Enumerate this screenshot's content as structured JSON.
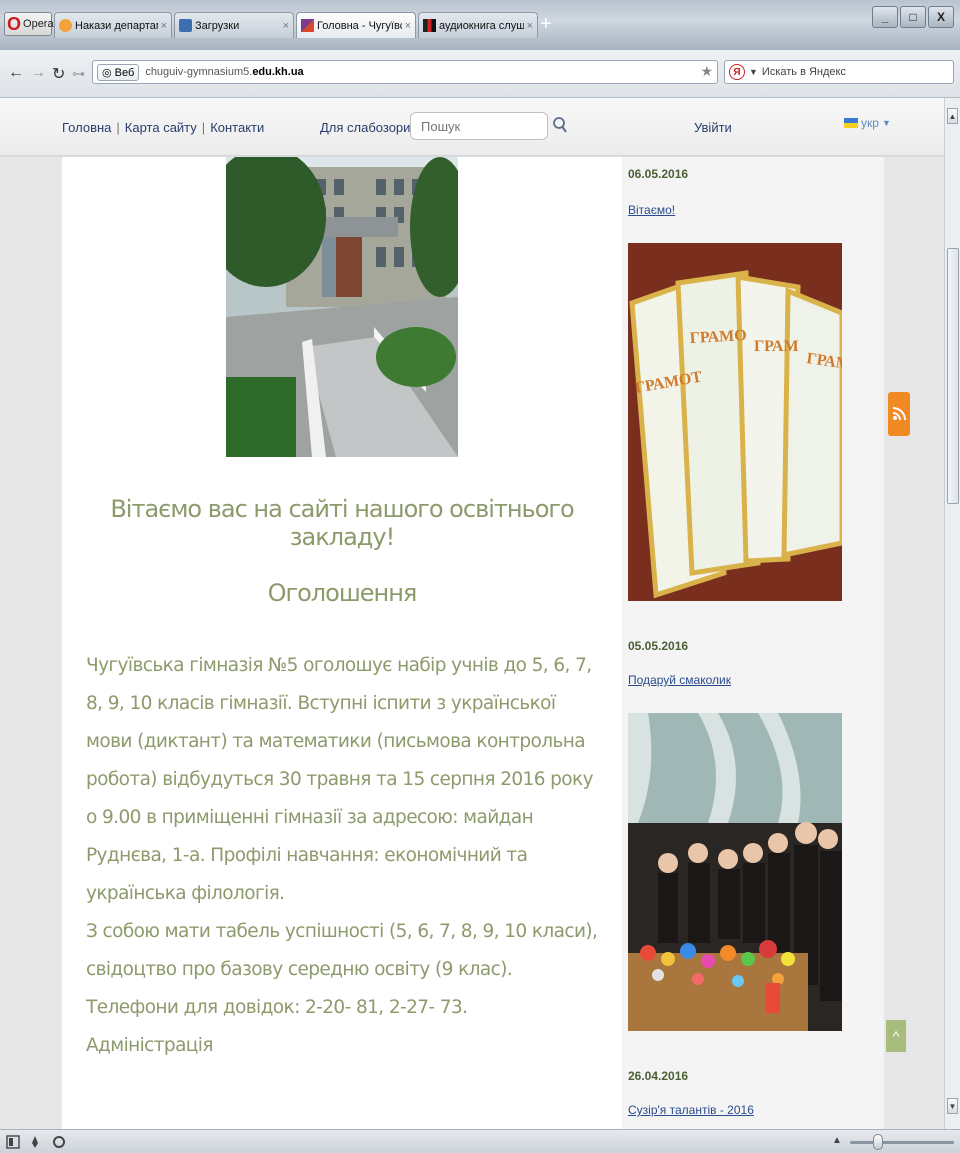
{
  "browser": {
    "menu_label": "Opera",
    "tabs": [
      {
        "label": "Накази департаменту ...",
        "close": "×"
      },
      {
        "label": "Загрузки",
        "close": "×"
      },
      {
        "label": "Головна - Чугуївська г...",
        "close": "×"
      },
      {
        "label": "аудиокнига слушать ...",
        "close": "×"
      }
    ],
    "new_tab": "+",
    "window_buttons": [
      "_",
      "□",
      "X"
    ],
    "web_badge": "Веб",
    "url_host": "chuguiv-gymnasium5.",
    "url_domain": "edu.kh.ua",
    "search_placeholder": "Искать в Яндекс"
  },
  "site_menu": {
    "links": [
      "Головна",
      "Карта сайту",
      "Контакти"
    ],
    "separator": "|",
    "low_vision": "Для слабозорих",
    "search_placeholder": "Пошук",
    "login": "Увійти",
    "language": "укр"
  },
  "main": {
    "welcome": "Вітаємо вас на сайті нашого освітнього закладу!",
    "announcement_title": "Оголошення",
    "announcement_paragraphs": [
      "Чугуївська гімназія №5 оголошує набір учнів до 5, 6, 7, 8, 9, 10 класів гімназії. Вступні іспити з української мови (диктант) та математики (письмова контрольна робота) відбудуться 30 травня та 15 серпня 2016 року о 9.00 в приміщенні гімназії за адресою: майдан Руднєва, 1-а. Профілі навчання: економічний та українська філологія.",
      "З собою мати табель успішності (5, 6, 7, 8, 9, 10 класи),",
      "свідоцтво про базову середню освіту (9 клас).",
      "Телефони для довідок: 2-20- 81, 2-27- 73.",
      "Адміністрація"
    ]
  },
  "news": [
    {
      "date": "06.05.2016",
      "title": "Вітаємо!"
    },
    {
      "date": "05.05.2016",
      "title": "Подаруй смаколик"
    },
    {
      "date": "26.04.2016",
      "title": "Сузір'я талантів - 2016"
    }
  ],
  "certificates_text": [
    "ГРАМОТ",
    "ГРАМО",
    "ГРАМ",
    "ГРАМ"
  ],
  "to_top": "^",
  "colors": {
    "body_text": "#8d9a6c",
    "news_date": "#4b5f35",
    "link": "#2a4b8d",
    "rss": "#f08a24"
  }
}
